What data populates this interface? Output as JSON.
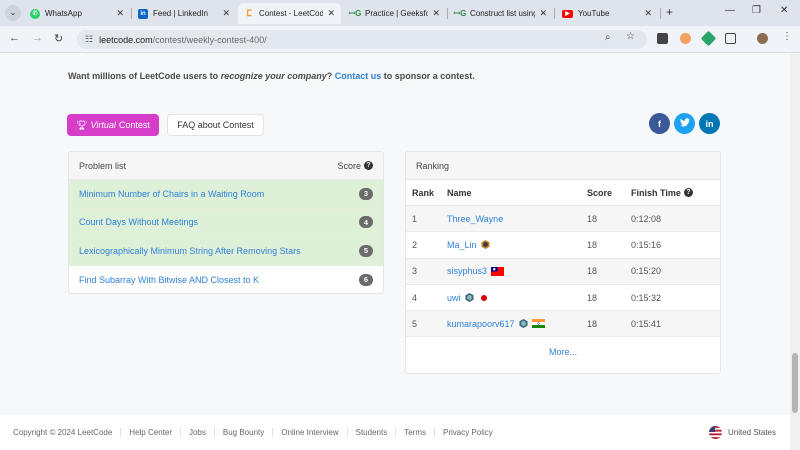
{
  "browser": {
    "tabs": [
      {
        "title": "WhatsApp",
        "icon": "whatsapp-icon",
        "color": "#25d366"
      },
      {
        "title": "Feed | LinkedIn",
        "icon": "linkedin-icon",
        "color": "#0a66c2"
      },
      {
        "title": "Contest - LeetCode",
        "icon": "leetcode-icon",
        "color": "#f89f1b"
      },
      {
        "title": "Practice | GeeksforGeeks",
        "icon": "gfg-icon",
        "color": "#2f8d46"
      },
      {
        "title": "Construct list using",
        "icon": "gfg-icon",
        "color": "#2f8d46"
      },
      {
        "title": "YouTube",
        "icon": "youtube-icon",
        "color": "#ff0000"
      }
    ],
    "url_host": "leetcode.com",
    "url_path": "/contest/weekly-contest-400/"
  },
  "sponsor": {
    "prefix": "Want millions of LeetCode users to ",
    "emphasis": "recognize your company",
    "middle": "? ",
    "link": "Contact us",
    "suffix": " to sponsor a contest."
  },
  "actions": {
    "virtual_label": "Virtual",
    "contest_label": "Contest",
    "faq_label": "FAQ about Contest"
  },
  "social": [
    {
      "icon": "facebook-icon",
      "glyph": "f",
      "color": "#3b5998"
    },
    {
      "icon": "twitter-icon",
      "glyph": "t",
      "color": "#1da1f2"
    },
    {
      "icon": "linkedin-icon",
      "glyph": "in",
      "color": "#0077b5"
    }
  ],
  "problems": {
    "header": "Problem list",
    "score_header": "Score",
    "items": [
      {
        "name": "Minimum Number of Chairs in a Waiting Room",
        "points": "3",
        "solved": true
      },
      {
        "name": "Count Days Without Meetings",
        "points": "4",
        "solved": true
      },
      {
        "name": "Lexicographically Minimum String After Removing Stars",
        "points": "5",
        "solved": true
      },
      {
        "name": "Find Subarray With Bitwise AND Closest to K",
        "points": "6",
        "solved": false
      }
    ]
  },
  "ranking": {
    "header": "Ranking",
    "columns": {
      "rank": "Rank",
      "name": "Name",
      "score": "Score",
      "time": "Finish Time"
    },
    "rows": [
      {
        "rank": "1",
        "name": "Three_Wayne",
        "score": "18",
        "time": "0:12:08"
      },
      {
        "rank": "2",
        "name": "Ma_Lin",
        "score": "18",
        "time": "0:15:16"
      },
      {
        "rank": "3",
        "name": "sisyphus3",
        "score": "18",
        "time": "0:15:20"
      },
      {
        "rank": "4",
        "name": "uwi",
        "score": "18",
        "time": "0:15:32"
      },
      {
        "rank": "5",
        "name": "kumarapoorv617",
        "score": "18",
        "time": "0:15:41"
      }
    ],
    "more": "More..."
  },
  "footer": {
    "copyright": "Copyright © 2024 LeetCode",
    "links": [
      "Help Center",
      "Jobs",
      "Bug Bounty",
      "Online Interview",
      "Students",
      "Terms",
      "Privacy Policy"
    ],
    "region": "United States"
  }
}
